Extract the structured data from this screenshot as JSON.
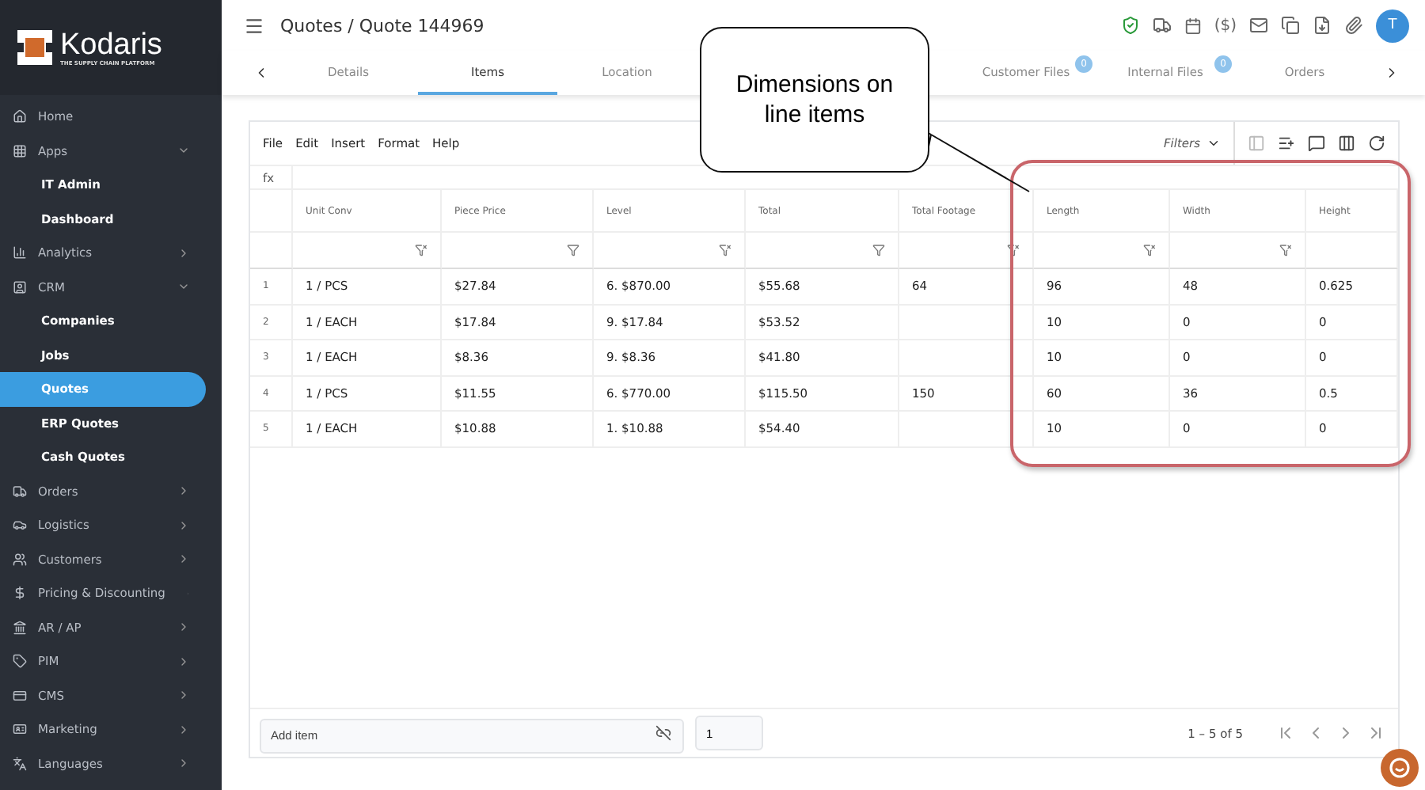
{
  "logo": {
    "name": "Kodaris",
    "tagline": "THE SUPPLY CHAIN PLATFORM"
  },
  "sidebar": {
    "items": [
      {
        "label": "Home",
        "kind": "link",
        "selected": false
      },
      {
        "label": "Apps",
        "kind": "group",
        "expanded": true,
        "selected": false
      },
      {
        "label": "IT Admin",
        "kind": "sub",
        "selected": false
      },
      {
        "label": "Dashboard",
        "kind": "sub",
        "selected": false
      },
      {
        "label": "Analytics",
        "kind": "group",
        "expanded": false,
        "selected": false
      },
      {
        "label": "CRM",
        "kind": "group",
        "expanded": true,
        "selected": false
      },
      {
        "label": "Companies",
        "kind": "sub",
        "selected": false
      },
      {
        "label": "Jobs",
        "kind": "sub",
        "selected": false
      },
      {
        "label": "Quotes",
        "kind": "sub",
        "selected": true
      },
      {
        "label": "ERP Quotes",
        "kind": "sub",
        "selected": false
      },
      {
        "label": "Cash Quotes",
        "kind": "sub",
        "selected": false
      },
      {
        "label": "Orders",
        "kind": "group",
        "expanded": false,
        "selected": false
      },
      {
        "label": "Logistics",
        "kind": "group",
        "expanded": false,
        "selected": false
      },
      {
        "label": "Customers",
        "kind": "group",
        "expanded": false,
        "selected": false
      },
      {
        "label": "Pricing & Discounting",
        "kind": "group",
        "expanded": false,
        "selected": false
      },
      {
        "label": "AR / AP",
        "kind": "group",
        "expanded": false,
        "selected": false
      },
      {
        "label": "PIM",
        "kind": "group",
        "expanded": false,
        "selected": false
      },
      {
        "label": "CMS",
        "kind": "group",
        "expanded": false,
        "selected": false
      },
      {
        "label": "Marketing",
        "kind": "group",
        "expanded": false,
        "selected": false
      },
      {
        "label": "Languages",
        "kind": "group",
        "expanded": false,
        "selected": false
      }
    ]
  },
  "header": {
    "breadcrumb": "Quotes / Quote 144969",
    "currency_button": "($)",
    "avatar": "T"
  },
  "tabs": [
    {
      "label": "Details",
      "selected": false
    },
    {
      "label": "Items",
      "selected": true
    },
    {
      "label": "Location",
      "selected": false
    },
    {
      "label": "Customer Files",
      "badge": "0",
      "selected": false
    },
    {
      "label": "Internal Files",
      "badge": "0",
      "selected": false
    },
    {
      "label": "Orders",
      "selected": false
    }
  ],
  "menu": [
    "File",
    "Edit",
    "Insert",
    "Format",
    "Help"
  ],
  "filters_label": "Filters",
  "formula_label": "fx",
  "table": {
    "columns": [
      {
        "label": "Unit Conv",
        "filter_active": false
      },
      {
        "label": "Piece Price",
        "filter_active": true
      },
      {
        "label": "Level",
        "filter_active": false
      },
      {
        "label": "Total",
        "filter_active": true
      },
      {
        "label": "Total Footage",
        "filter_active": false
      },
      {
        "label": "Length",
        "filter_active": false
      },
      {
        "label": "Width",
        "filter_active": false
      },
      {
        "label": "Height"
      }
    ],
    "rows": [
      {
        "num": "1",
        "cells": [
          "1 / PCS",
          "$27.84",
          "6. $870.00",
          "$55.68",
          "64",
          "96",
          "48",
          "0.625"
        ]
      },
      {
        "num": "2",
        "cells": [
          "1 / EACH",
          "$17.84",
          "9. $17.84",
          "$53.52",
          "",
          "10",
          "0",
          "0"
        ]
      },
      {
        "num": "3",
        "cells": [
          "1 / EACH",
          "$8.36",
          "9. $8.36",
          "$41.80",
          "",
          "10",
          "0",
          "0"
        ]
      },
      {
        "num": "4",
        "cells": [
          "1 / PCS",
          "$11.55",
          "6. $770.00",
          "$115.50",
          "150",
          "60",
          "36",
          "0.5"
        ]
      },
      {
        "num": "5",
        "cells": [
          "1 / EACH",
          "$10.88",
          "1. $10.88",
          "$54.40",
          "",
          "10",
          "0",
          "0"
        ]
      }
    ]
  },
  "footer": {
    "add_item_placeholder": "Add item",
    "quantity": "1",
    "pagination": "1 – 5 of 5"
  },
  "callout": {
    "text": "Dimensions on line items"
  }
}
